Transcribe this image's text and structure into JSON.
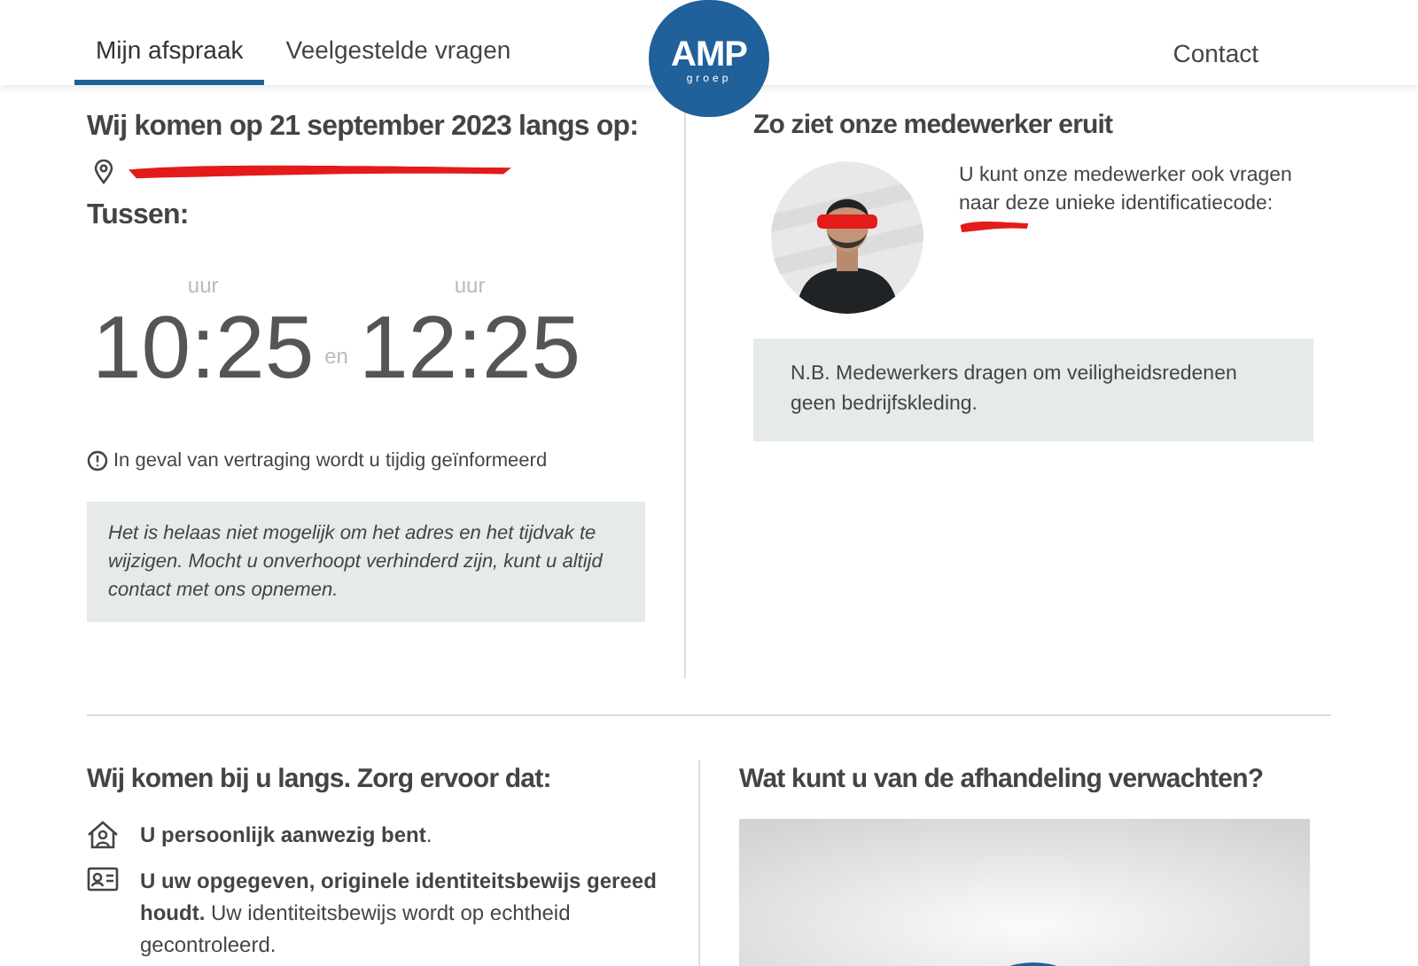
{
  "nav": {
    "tabs": [
      {
        "label": "Mijn afspraak",
        "selected": true
      },
      {
        "label": "Veelgestelde vragen",
        "selected": false
      }
    ],
    "logo": {
      "text": "AMP",
      "subtext": "groep"
    },
    "contact": "Contact"
  },
  "appointment": {
    "heading": "Wij komen op 21 september 2023 langs op:",
    "between_label": "Tussen:",
    "times": [
      {
        "unit": "uur",
        "time": "10:25"
      },
      {
        "unit": "uur",
        "time": "12:25"
      }
    ],
    "joiner": "en",
    "delay_note": "In geval van vertraging wordt u tijdig geïnformeerd",
    "notice": "Het is helaas niet mogelijk om het adres en het tijdvak te wijzigen. Mocht u onverhoopt verhinderd zijn, kunt u altijd contact met ons opnemen."
  },
  "employee": {
    "heading": "Zo ziet onze medewerker eruit",
    "text": "U kunt onze medewerker ook vragen naar deze unieke identificatiecode:",
    "notice": "N.B. Medewerkers dragen om veiligheidsredenen geen bedrijfskleding."
  },
  "checklist": {
    "heading": "Wij komen bij u langs. Zorg ervoor dat:",
    "items": [
      {
        "kind": "home",
        "text": "**U persoonlijk aanwezig bent**."
      },
      {
        "kind": "id",
        "text": "**U uw opgegeven, originele identiteitsbewijs gereed houdt.** Uw identiteitsbewijs wordt op echtheid gecontroleerd."
      }
    ]
  },
  "expectations": {
    "heading": "Wat kunt u van de afhandeling verwachten?"
  }
}
